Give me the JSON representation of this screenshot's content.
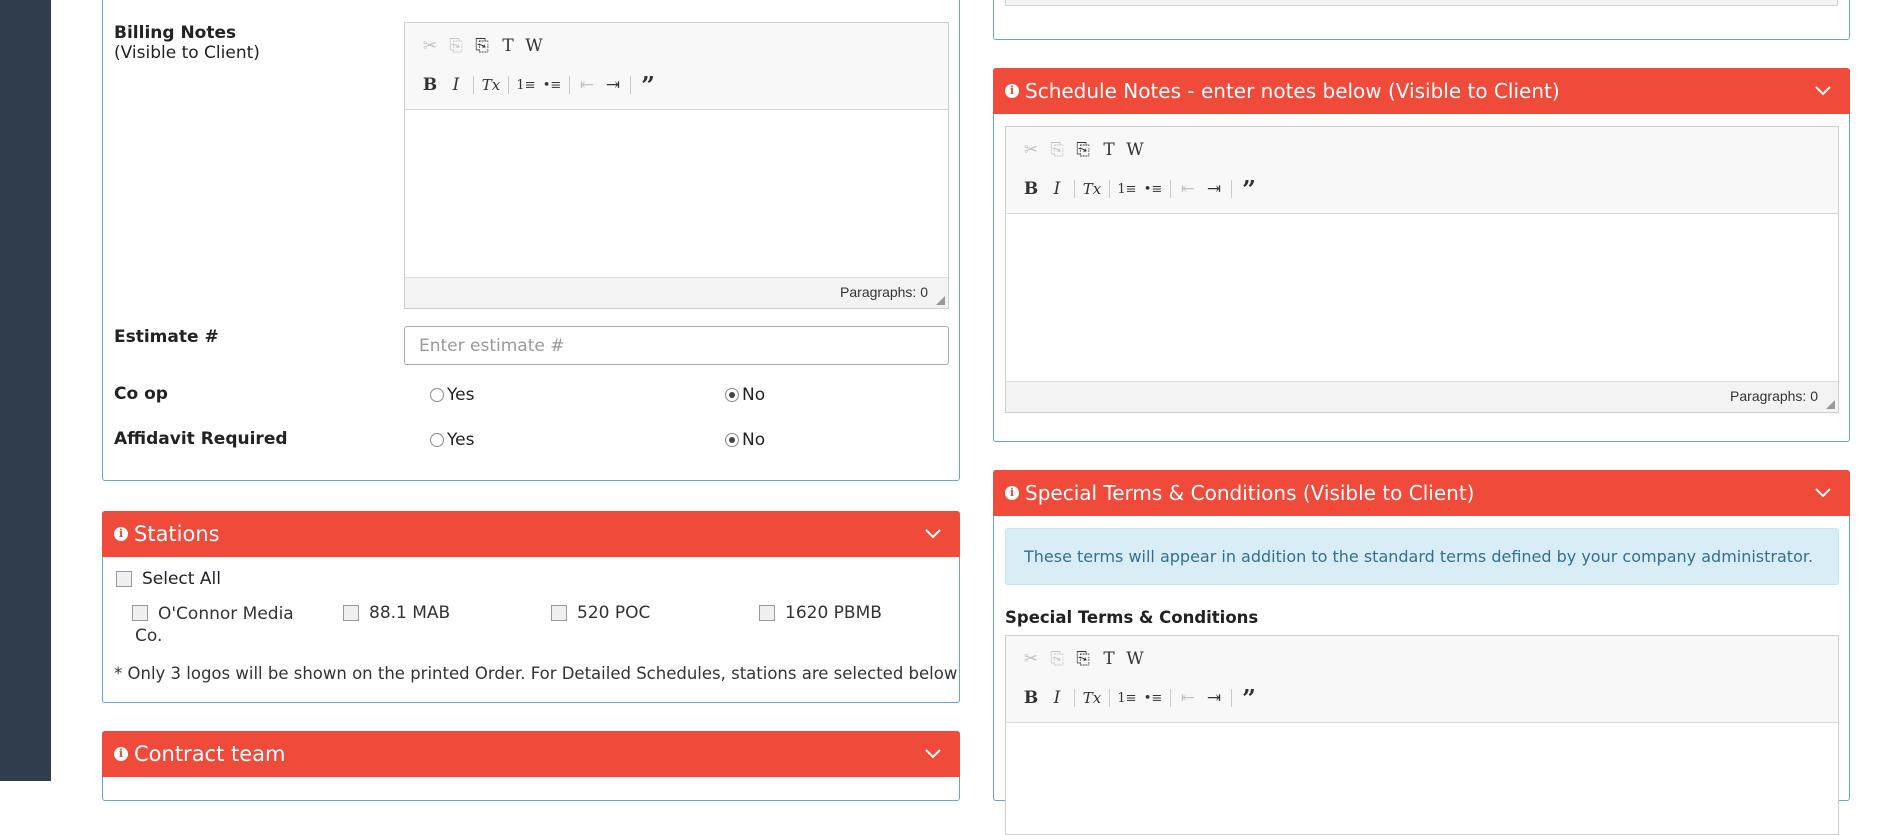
{
  "editor_toolbar": {
    "cut": "✂",
    "copy": "⎘",
    "paste": "⎘",
    "paste_text": "T",
    "paste_word": "W",
    "bold": "B",
    "italic": "I",
    "remove_format": "Tx",
    "numbered_list": "1≡",
    "bulleted_list": "•≡",
    "outdent": "⇤",
    "indent": "⇥",
    "blockquote": "”"
  },
  "left": {
    "billing_notes": {
      "label": "Billing Notes",
      "sublabel": "(Visible to Client)",
      "status": "Paragraphs: 0"
    },
    "estimate": {
      "label": "Estimate #",
      "placeholder": "Enter estimate #",
      "value": ""
    },
    "coop": {
      "label": "Co op",
      "yes": "Yes",
      "no": "No",
      "selected": "No"
    },
    "affidavit": {
      "label": "Affidavit Required",
      "yes": "Yes",
      "no": "No",
      "selected": "No"
    }
  },
  "stations": {
    "title": "Stations",
    "select_all": "Select All",
    "items": [
      "O'Connor Media Co.",
      "88.1 MAB",
      "520 POC",
      "1620 PBMB"
    ],
    "footnote": "* Only 3 logos will be shown on the printed Order. For Detailed Schedules, stations are selected below"
  },
  "contract_team": {
    "title": "Contract team"
  },
  "schedule_notes": {
    "title": "Schedule Notes - enter notes below (Visible to Client)",
    "status": "Paragraphs: 0"
  },
  "special_terms": {
    "title": "Special Terms & Conditions (Visible to Client)",
    "alert": "These terms will appear in addition to the standard terms defined by your company administrator.",
    "field_label": "Special Terms & Conditions"
  },
  "colors": {
    "header_red": "#ef4a3a",
    "panel_border": "#62a6d9",
    "sidebar": "#2f3d4c",
    "alert_bg": "#d9edf7"
  }
}
